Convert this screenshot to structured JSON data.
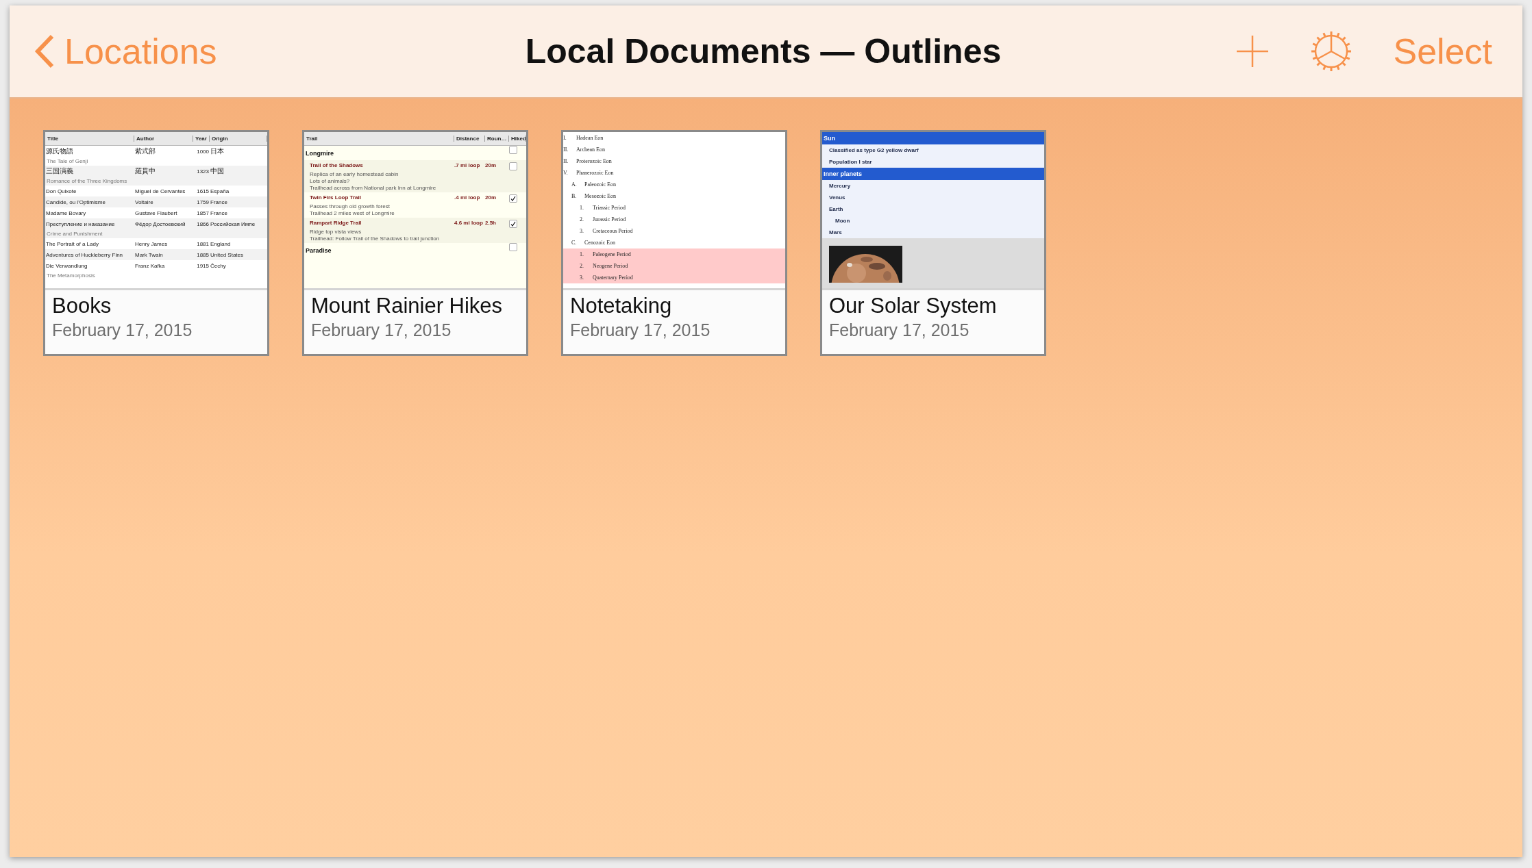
{
  "nav_bar": {
    "back_label": "Locations",
    "title": "Local Documents — Outlines",
    "action_label": "Select"
  },
  "documents": [
    {
      "kind": "table",
      "name": "Books",
      "date": "February 17, 2015",
      "columns": [
        "Title",
        "Author",
        "Year",
        "Origin"
      ],
      "rows": [
        {
          "cells": [
            "源氏物語",
            "紫式部",
            "1000",
            "日本"
          ],
          "note": "The Tale of Genji"
        },
        {
          "cells": [
            "三国演義",
            "羅貫中",
            "1323",
            "中国"
          ],
          "note": "Romance of the Three Kingdoms"
        },
        {
          "cells": [
            "Don Quixote",
            "Miguel de Cervantes",
            "1615",
            "España"
          ]
        },
        {
          "cells": [
            "Candide, ou l'Optimisme",
            "Voltaire",
            "1759",
            "France"
          ]
        },
        {
          "cells": [
            "Madame Bovary",
            "Gustave Flaubert",
            "1857",
            "France"
          ]
        },
        {
          "cells": [
            "Преступление и наказание",
            "Фёдор Достоевский",
            "1866",
            "Российская Импе"
          ],
          "note": "Crime and Punishment"
        },
        {
          "cells": [
            "The Portrait of a Lady",
            "Henry James",
            "1881",
            "England"
          ]
        },
        {
          "cells": [
            "Adventures of Huckleberry Finn",
            "Mark Twain",
            "1885",
            "United States"
          ]
        },
        {
          "cells": [
            "Die Verwandlung",
            "Franz Kafka",
            "1915",
            "Čechy"
          ],
          "note": "The Metamorphosis"
        }
      ]
    },
    {
      "kind": "checklist",
      "name": "Mount Rainier Hikes",
      "date": "February 17, 2015",
      "columns": [
        "Trail",
        "Distance",
        "Roun…",
        "Hiked"
      ],
      "groups": [
        {
          "name": "Longmire",
          "checked": false,
          "trails": [
            {
              "name": "Trail of the Shadows",
              "distance": ".7 mi loop",
              "time": "20m",
              "checked": false,
              "notes": [
                "Replica of an early homestead cabin",
                "Lots of animals?",
                "Trailhead across from National park Inn at Longmire"
              ]
            },
            {
              "name": "Twin Firs Loop Trail",
              "distance": ".4 mi loop",
              "time": "20m",
              "checked": true,
              "notes": [
                "Passes through old growth forest",
                "Trailhead 2 miles west of Longmire"
              ]
            },
            {
              "name": "Rampart Ridge Trail",
              "distance": "4.6 mi loop",
              "time": "2.5h",
              "checked": true,
              "notes": [
                "Ridge top vista views",
                "Trailhead: Follow Trail of the Shadows to trail junction"
              ]
            }
          ]
        },
        {
          "name": "Paradise",
          "checked": false
        }
      ]
    },
    {
      "kind": "outline",
      "name": "Notetaking",
      "date": "February 17, 2015",
      "items": [
        {
          "marker": "I.",
          "text": "Hadean Eon",
          "selected": false
        },
        {
          "marker": "II.",
          "text": "Archean Eon",
          "selected": false
        },
        {
          "marker": "II.",
          "text": "Proterozoic Eon",
          "selected": false
        },
        {
          "marker": "V.",
          "text": "Phanerozoic Eon",
          "selected": false,
          "children": [
            {
              "marker": "A.",
              "text": "Paleozoic Eon",
              "selected": false
            },
            {
              "marker": "B.",
              "text": "Mesozoic Eon",
              "selected": false,
              "children": [
                {
                  "marker": "1.",
                  "text": "Triassic Period",
                  "selected": false
                },
                {
                  "marker": "2.",
                  "text": "Jurassic Period",
                  "selected": false
                },
                {
                  "marker": "3.",
                  "text": "Cretaceous Period",
                  "selected": false
                }
              ]
            },
            {
              "marker": "C.",
              "text": "Cenozoic Eon",
              "selected": false,
              "children": [
                {
                  "marker": "1.",
                  "text": "Paleogene Period",
                  "selected": true
                },
                {
                  "marker": "2.",
                  "text": "Neogene Period",
                  "selected": true
                },
                {
                  "marker": "3.",
                  "text": "Quaternary Period",
                  "selected": true
                }
              ]
            }
          ]
        }
      ]
    },
    {
      "kind": "sections",
      "name": "Our Solar System",
      "date": "February 17, 2015",
      "rows": [
        {
          "kind": "heading",
          "text": "Sun"
        },
        {
          "kind": "item",
          "text": "Classified as type G2 yellow dwarf"
        },
        {
          "kind": "item",
          "text": "Population I star"
        },
        {
          "kind": "heading",
          "text": "Inner planets"
        },
        {
          "kind": "item",
          "text": "Mercury"
        },
        {
          "kind": "item",
          "text": "Venus"
        },
        {
          "kind": "item",
          "text": "Earth",
          "children": [
            {
              "kind": "item",
              "text": "Moon"
            }
          ]
        },
        {
          "kind": "item",
          "text": "Mars"
        },
        {
          "kind": "picture"
        }
      ]
    }
  ]
}
